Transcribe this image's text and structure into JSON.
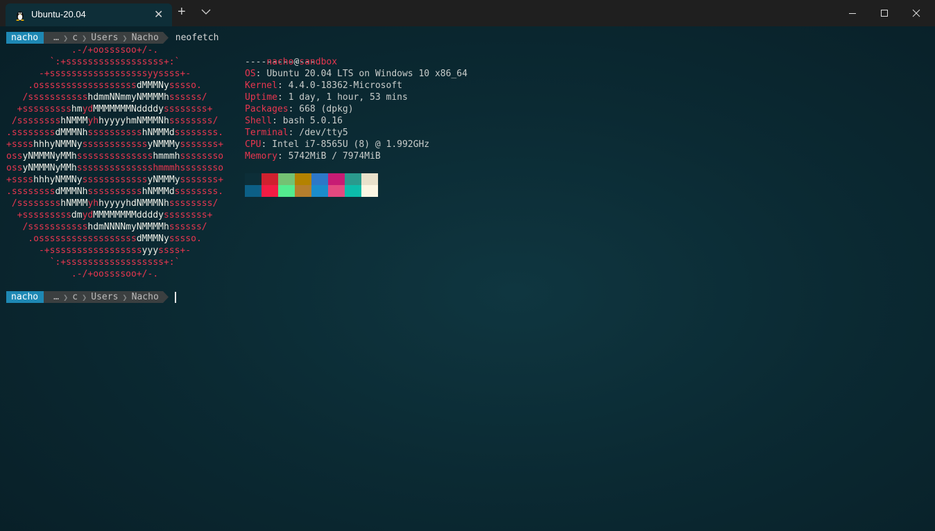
{
  "window": {
    "tab_title": "Ubuntu-20.04",
    "tab_icon": "linux-penguin-icon",
    "close_tab_glyph": "✕",
    "new_tab_glyph": "+",
    "dropdown_icon": "chevron-down-icon",
    "minimize_icon": "minimize-icon",
    "maximize_icon": "maximize-icon",
    "close_icon": "close-icon"
  },
  "prompt1": {
    "user": "nacho",
    "path": [
      "…",
      "c",
      "Users",
      "Nacho"
    ],
    "command": "neofetch"
  },
  "prompt2": {
    "user": "nacho",
    "path": [
      "…",
      "c",
      "Users",
      "Nacho"
    ],
    "command": ""
  },
  "ascii_art": [
    [
      [
        "red",
        "            .-/+oossssoo+/-."
      ]
    ],
    [
      [
        "red",
        "        `:+ssssssssssssssssss+:`"
      ]
    ],
    [
      [
        "red",
        "      -+ssssssssssssssssssyyssss+-"
      ]
    ],
    [
      [
        "red",
        "    .ossssssssssssssssss"
      ],
      [
        "wht",
        "dMMMNy"
      ],
      [
        "red",
        "sssso."
      ]
    ],
    [
      [
        "red",
        "   /sssssssssss"
      ],
      [
        "wht",
        "hdmmNNmmyNMMMMh"
      ],
      [
        "red",
        "ssssss/"
      ]
    ],
    [
      [
        "red",
        "  +sssssssss"
      ],
      [
        "wht",
        "hm"
      ],
      [
        "red",
        "yd"
      ],
      [
        "wht",
        "MMMMMMMNddddy"
      ],
      [
        "red",
        "ssssssss+"
      ]
    ],
    [
      [
        "red",
        " /ssssssss"
      ],
      [
        "wht",
        "hNMMM"
      ],
      [
        "red",
        "yh"
      ],
      [
        "wht",
        "hyyyyhmNMMMNh"
      ],
      [
        "red",
        "ssssssss/"
      ]
    ],
    [
      [
        "red",
        ".ssssssss"
      ],
      [
        "wht",
        "dMMMNh"
      ],
      [
        "red",
        "ssssssssss"
      ],
      [
        "wht",
        "hNMMMd"
      ],
      [
        "red",
        "ssssssss."
      ]
    ],
    [
      [
        "red",
        "+ssss"
      ],
      [
        "wht",
        "hhhyNMMNy"
      ],
      [
        "red",
        "ssssssssssss"
      ],
      [
        "wht",
        "yNMMMy"
      ],
      [
        "red",
        "sssssss+"
      ]
    ],
    [
      [
        "red",
        "oss"
      ],
      [
        "wht",
        "yNMMMNyMMh"
      ],
      [
        "red",
        "ssssssssssssss"
      ],
      [
        "wht",
        "hmmmh"
      ],
      [
        "red",
        "ssssssso"
      ]
    ],
    [
      [
        "red",
        "oss"
      ],
      [
        "wht",
        "yNMMMNyMMh"
      ],
      [
        "red",
        "sssssssssssssshmmmhssssssso"
      ]
    ],
    [
      [
        "red",
        "+ssss"
      ],
      [
        "wht",
        "hhhyNMMNy"
      ],
      [
        "red",
        "ssssssssssss"
      ],
      [
        "wht",
        "yNMMMy"
      ],
      [
        "red",
        "sssssss+"
      ]
    ],
    [
      [
        "red",
        ".ssssssss"
      ],
      [
        "wht",
        "dMMMNh"
      ],
      [
        "red",
        "ssssssssss"
      ],
      [
        "wht",
        "hNMMMd"
      ],
      [
        "red",
        "ssssssss."
      ]
    ],
    [
      [
        "red",
        " /ssssssss"
      ],
      [
        "wht",
        "hNMMM"
      ],
      [
        "red",
        "yh"
      ],
      [
        "wht",
        "hyyyyhdNMMMNh"
      ],
      [
        "red",
        "ssssssss/"
      ]
    ],
    [
      [
        "red",
        "  +sssssssss"
      ],
      [
        "wht",
        "dm"
      ],
      [
        "red",
        "yd"
      ],
      [
        "wht",
        "MMMMMMMMddddy"
      ],
      [
        "red",
        "ssssssss+"
      ]
    ],
    [
      [
        "red",
        "   /sssssssssss"
      ],
      [
        "wht",
        "hdmNNNNmyNMMMMh"
      ],
      [
        "red",
        "ssssss/"
      ]
    ],
    [
      [
        "red",
        "    .ossssssssssssssssss"
      ],
      [
        "wht",
        "dMMMNy"
      ],
      [
        "red",
        "sssso."
      ]
    ],
    [
      [
        "red",
        "      -+sssssssssssssssss"
      ],
      [
        "wht",
        "yyy"
      ],
      [
        "red",
        "ssss+-"
      ]
    ],
    [
      [
        "red",
        "        `:+ssssssssssssssssss+:`"
      ]
    ],
    [
      [
        "red",
        "            .-/+oossssoo+/-."
      ]
    ]
  ],
  "info": {
    "user": "nacho",
    "at": "@",
    "host": "sandbox",
    "separator": "-------------",
    "fields": [
      {
        "key": "OS",
        "value": "Ubuntu 20.04 LTS on Windows 10 x86_64"
      },
      {
        "key": "Kernel",
        "value": "4.4.0-18362-Microsoft"
      },
      {
        "key": "Uptime",
        "value": "1 day, 1 hour, 53 mins"
      },
      {
        "key": "Packages",
        "value": "668 (dpkg)"
      },
      {
        "key": "Shell",
        "value": "bash 5.0.16"
      },
      {
        "key": "Terminal",
        "value": "/dev/tty5"
      },
      {
        "key": "CPU",
        "value": "Intel i7-8565U (8) @ 1.992GHz"
      },
      {
        "key": "Memory",
        "value": "5742MiB / 7974MiB"
      }
    ]
  },
  "palette": {
    "row1": [
      "#0c2e38",
      "#d0212f",
      "#74c273",
      "#b38200",
      "#2d78c8",
      "#c71c74",
      "#2a9a8d",
      "#e9e1cb"
    ],
    "row2": [
      "#0c5f86",
      "#f21c44",
      "#53eb8f",
      "#b57e2d",
      "#1b8ccb",
      "#e34980",
      "#0cbcaa",
      "#fcf6e3"
    ]
  }
}
